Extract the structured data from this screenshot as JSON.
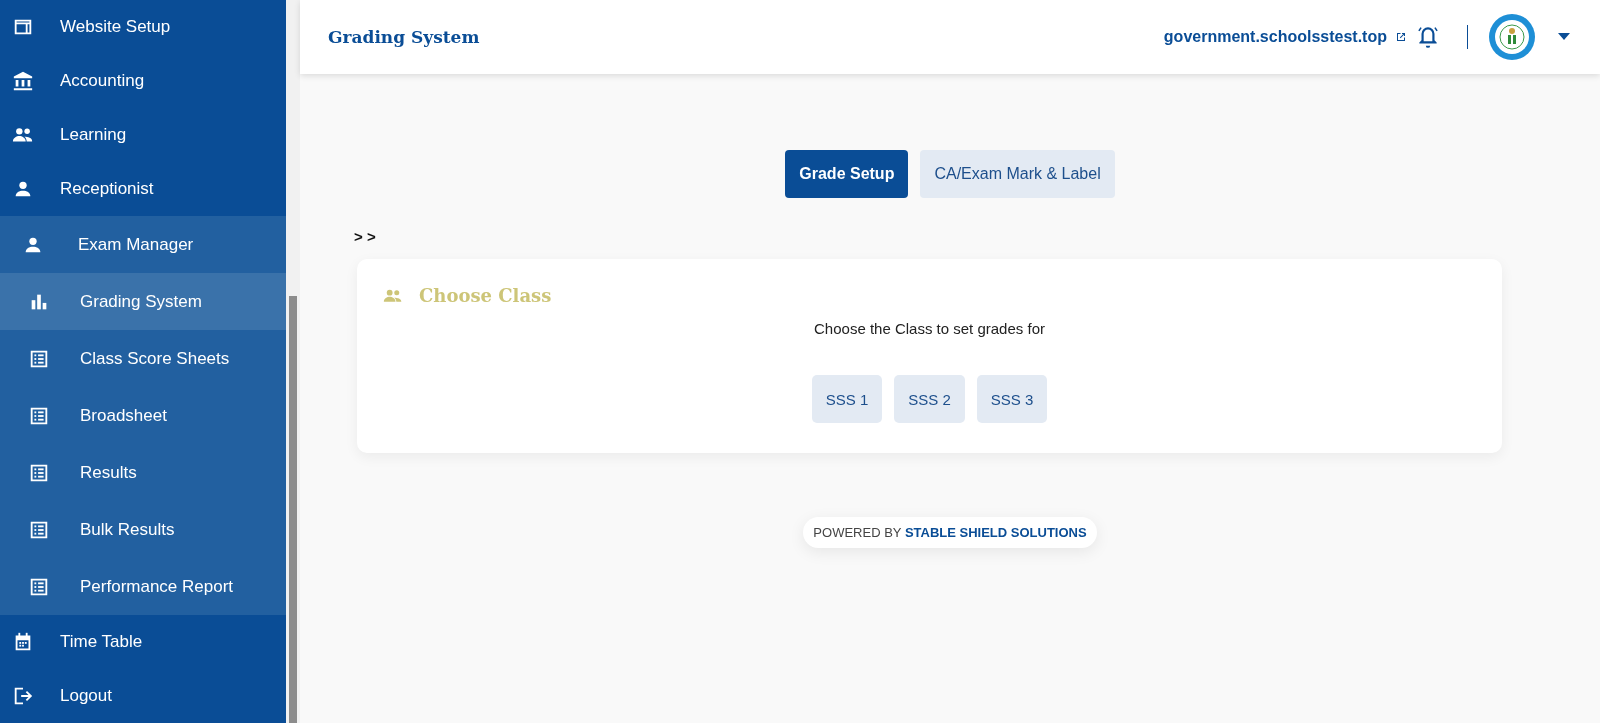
{
  "sidebar": {
    "items": [
      {
        "label": "Website Setup",
        "selected": false
      },
      {
        "label": "Accounting",
        "selected": false
      },
      {
        "label": "Learning",
        "selected": false
      },
      {
        "label": "Receptionist",
        "selected": false
      },
      {
        "label": "Exam Manager",
        "selected": false,
        "expanded": true,
        "children": [
          {
            "label": "Grading System",
            "selected": true
          },
          {
            "label": "Class Score Sheets",
            "selected": false
          },
          {
            "label": "Broadsheet",
            "selected": false
          },
          {
            "label": "Results",
            "selected": false
          },
          {
            "label": "Bulk Results",
            "selected": false
          },
          {
            "label": "Performance Report",
            "selected": false
          }
        ]
      },
      {
        "label": "Time Table",
        "selected": false
      },
      {
        "label": "Logout",
        "selected": false
      }
    ]
  },
  "header": {
    "title": "Grading System",
    "site_link": "government.schoolsstest.top"
  },
  "tabs": [
    {
      "label": "Grade Setup",
      "selected": true
    },
    {
      "label": "CA/Exam Mark & Label",
      "selected": false
    }
  ],
  "breadcrumb": "> >",
  "card": {
    "title": "Choose Class",
    "instruction": "Choose the Class to set grades for",
    "classes": [
      "SSS 1",
      "SSS 2",
      "SSS 3"
    ]
  },
  "footer": {
    "prefix": "POWERED BY",
    "brand": "STABLE SHIELD SOLUTIONS"
  }
}
